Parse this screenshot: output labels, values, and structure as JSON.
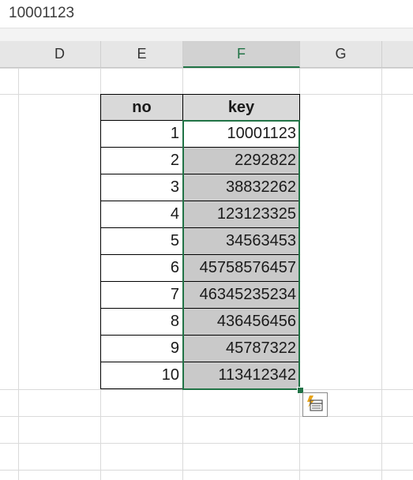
{
  "formula_bar": {
    "value": "10001123"
  },
  "columns": [
    {
      "label": "D",
      "selected": false
    },
    {
      "label": "E",
      "selected": false
    },
    {
      "label": "F",
      "selected": true
    },
    {
      "label": "G",
      "selected": false
    }
  ],
  "table": {
    "headers": [
      "no",
      "key"
    ],
    "rows": [
      {
        "no": "1",
        "key": "10001123"
      },
      {
        "no": "2",
        "key": "2292822"
      },
      {
        "no": "3",
        "key": "38832262"
      },
      {
        "no": "4",
        "key": "123123325"
      },
      {
        "no": "5",
        "key": "34563453"
      },
      {
        "no": "6",
        "key": "45758576457"
      },
      {
        "no": "7",
        "key": "46345235234"
      },
      {
        "no": "8",
        "key": "436456456"
      },
      {
        "no": "9",
        "key": "45787322"
      },
      {
        "no": "10",
        "key": "113412342"
      }
    ]
  },
  "icons": {
    "quick_analysis": "quick-analysis-icon"
  },
  "colors": {
    "selection": "#217346",
    "header_fill": "#d9d9d9",
    "key_fill": "#c9c9c9"
  }
}
